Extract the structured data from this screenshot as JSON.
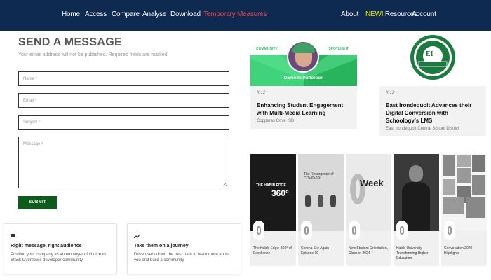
{
  "nav": {
    "left": [
      "Home",
      "Access",
      "Compare",
      "Analyse",
      "Download",
      "Temporary Measures"
    ],
    "right_about": "About",
    "right_new": "NEW!",
    "right_resources": "Resources",
    "right_account": "Account"
  },
  "form": {
    "title": "SEND A MESSAGE",
    "subtitle": "Your email address will not be published. Required fields are marked.",
    "name_placeholder": "Name *",
    "email_placeholder": "Email *",
    "subject_placeholder": "Subject *",
    "message_placeholder": "Message *",
    "submit": "SUBMIT"
  },
  "info_cards": [
    {
      "icon": "flag-icon",
      "heading": "Right message, right audience",
      "body": "Position your company as an employer of choice to Stack Overflow's developer community."
    },
    {
      "icon": "trend-icon",
      "heading": "Take them on a journey",
      "body": "Drive users down the best path to learn more about you and build a community."
    }
  ],
  "articles": [
    {
      "banner_left": "COMMUNITY",
      "banner_right": "SPOTLIGHT",
      "person": "Danielle Patterson",
      "kicker": "K 12",
      "title": "Enhancing Student Engagement with Multi-Media Learning",
      "source": "Copperas Cove ISD"
    },
    {
      "kicker": "K 12",
      "title": "East Irondequoit Advances their Digital Conversion with Schoology's LMS",
      "source": "East Irondequoit Central School District"
    }
  ],
  "videos": [
    {
      "thumb_text": "THE HABIB EDGE",
      "caption": "The Habib Edge: 360° of Excellence"
    },
    {
      "thumb_text": "The Resurgence of COVID-19:",
      "caption": "Corona Sky Again - Episode 19"
    },
    {
      "thumb_text": "Week",
      "caption": "New Student Orientation, Class of 2024"
    },
    {
      "thumb_text": "",
      "caption": "Habib University - Transforming Higher Education"
    },
    {
      "thumb_text": "",
      "caption": "Convocation 2020 Highlights"
    }
  ],
  "colors": {
    "nav_bg": "#0e2a50",
    "accent_red": "#e8464b",
    "new_yellow": "#f3e600",
    "submit_green": "#0f5a1d",
    "spotlight_green": "#2ec86a"
  }
}
